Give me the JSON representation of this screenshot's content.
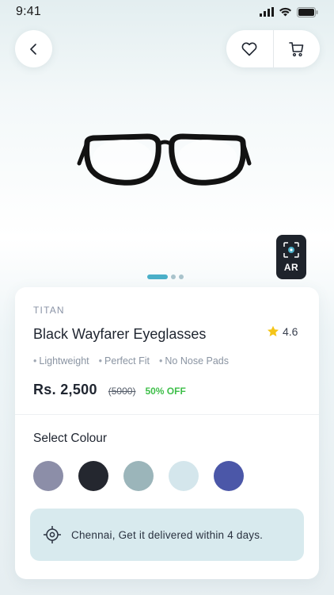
{
  "status_bar": {
    "time": "9:41"
  },
  "product": {
    "brand": "TITAN",
    "title": "Black Wayfarer  Eyeglasses",
    "rating": "4.6",
    "features": [
      "Lightweight",
      "Perfect Fit",
      "No Nose Pads"
    ],
    "price": "Rs. 2,500",
    "original_price": "(5000)",
    "discount": "50% OFF"
  },
  "ar_badge": {
    "label": "AR"
  },
  "carousel": {
    "total": 3,
    "active_index": 0
  },
  "colour_section": {
    "title": "Select Colour",
    "swatches": [
      "#8c8ea8",
      "#24272f",
      "#9bb5ba",
      "#d4e6ec",
      "#4b57a8"
    ]
  },
  "delivery": {
    "text": "Chennai, Get it delivered within 4 days."
  },
  "icons": [
    "back-arrow-icon",
    "heart-icon",
    "cart-icon",
    "ar-scan-icon",
    "star-icon",
    "location-target-icon",
    "signal-icon",
    "wifi-icon",
    "battery-icon"
  ],
  "colors": {
    "accent": "#4aafc8",
    "discount": "#3fbf4a",
    "rating_star": "#f5c518",
    "ar_badge_bg": "#1e232b"
  }
}
